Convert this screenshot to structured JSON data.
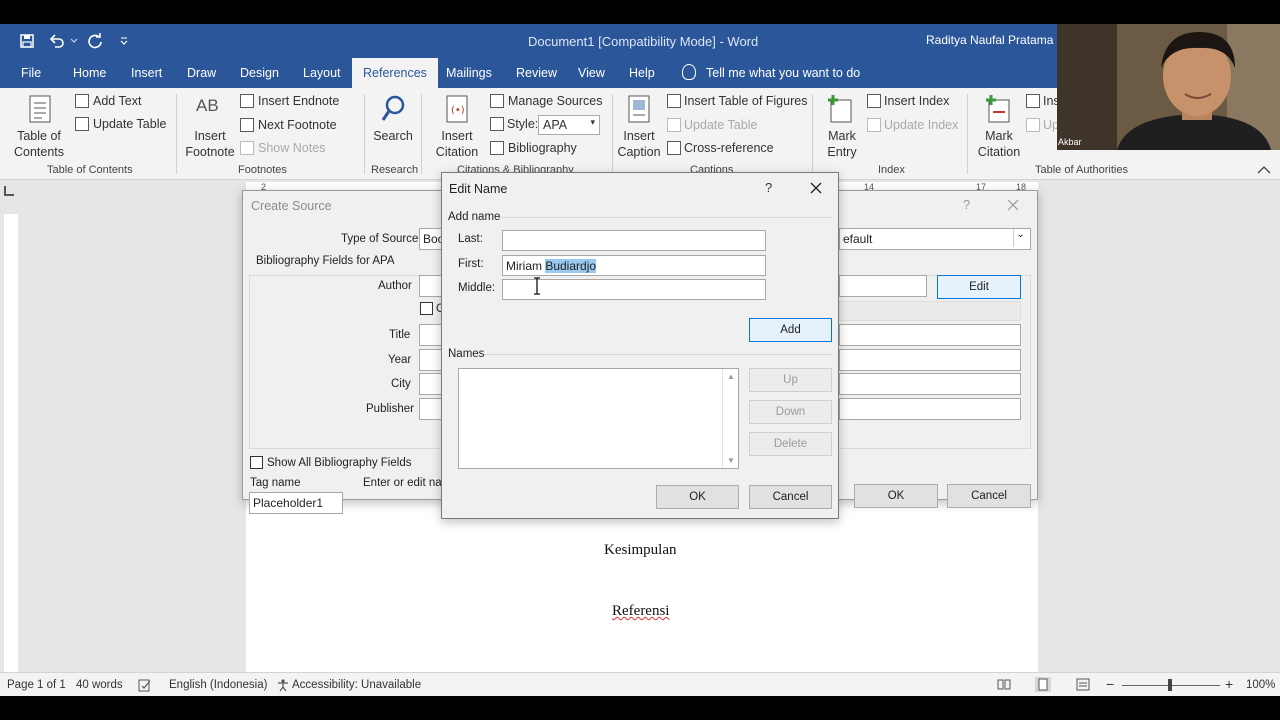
{
  "window": {
    "title": "Document1 [Compatibility Mode]  -  Word",
    "user": "Raditya Naufal Pratama",
    "cam_label": "Akbar"
  },
  "tabs": [
    "File",
    "Home",
    "Insert",
    "Draw",
    "Design",
    "Layout",
    "References",
    "Mailings",
    "Review",
    "View",
    "Help"
  ],
  "tell_me": "Tell me what you want to do",
  "ribbon": {
    "toc": {
      "label1": "Table of",
      "label2": "Contents",
      "add_text": "Add Text",
      "update_table": "Update Table",
      "group": "Table of Contents"
    },
    "footnotes": {
      "insert1": "Insert",
      "insert2": "Footnote",
      "insert_endnote": "Insert Endnote",
      "next_footnote": "Next Footnote",
      "show_notes": "Show Notes",
      "group": "Footnotes",
      "ab": "AB"
    },
    "research": {
      "search": "Search",
      "group": "Research"
    },
    "citations": {
      "insert1": "Insert",
      "insert2": "Citation",
      "manage_sources": "Manage Sources",
      "style_label": "Style:",
      "style_value": "APA",
      "bibliography": "Bibliography",
      "group": "Citations & Bibliography"
    },
    "captions": {
      "insert1": "Insert",
      "insert2": "Caption",
      "insert_tof": "Insert Table of Figures",
      "update_table": "Update Table",
      "cross_reference": "Cross-reference",
      "group": "Captions"
    },
    "index": {
      "mark1": "Mark",
      "mark2": "Entry",
      "insert_index": "Insert Index",
      "update_index": "Update Index",
      "group": "Index"
    },
    "authorities": {
      "mark1": "Mark",
      "mark2": "Citation",
      "insert": "Ins",
      "update": "Up",
      "group": "Table of Authorities"
    }
  },
  "create_source": {
    "title": "Create Source",
    "type_label": "Type of Source",
    "type_value": "Boo",
    "language_value": "efault",
    "fields_heading": "Bibliography Fields for APA",
    "author_label": "Author",
    "corporate_check": "C",
    "edit_button": "Edit",
    "title_label": "Title",
    "year_label": "Year",
    "city_label": "City",
    "publisher_label": "Publisher",
    "show_all": "Show All Bibliography Fields",
    "tag_name_label": "Tag name",
    "enter_edit": "Enter or edit nam",
    "tag_value": "Placeholder1",
    "ok": "OK",
    "cancel": "Cancel",
    "help": "?"
  },
  "edit_name": {
    "title": "Edit Name",
    "help": "?",
    "add_name": "Add name",
    "last_label": "Last:",
    "last_value": "",
    "first_label": "First:",
    "first_value_plain": "Miriam ",
    "first_value_selected": "Budiardjo",
    "middle_label": "Middle:",
    "middle_value": "",
    "add_button": "Add",
    "names_label": "Names",
    "up": "Up",
    "down": "Down",
    "delete": "Delete",
    "ok": "OK",
    "cancel": "Cancel"
  },
  "document": {
    "heading1": "Kesimpulan",
    "heading2": "Referensi"
  },
  "ruler_marks": [
    "2",
    "14",
    "17",
    "18"
  ],
  "status": {
    "page": "Page 1 of 1",
    "words": "40 words",
    "language": "English (Indonesia)",
    "accessibility": "Accessibility: Unavailable",
    "zoom": "100%"
  },
  "colors": {
    "brand": "#2b579a",
    "accent": "#0078d7"
  }
}
